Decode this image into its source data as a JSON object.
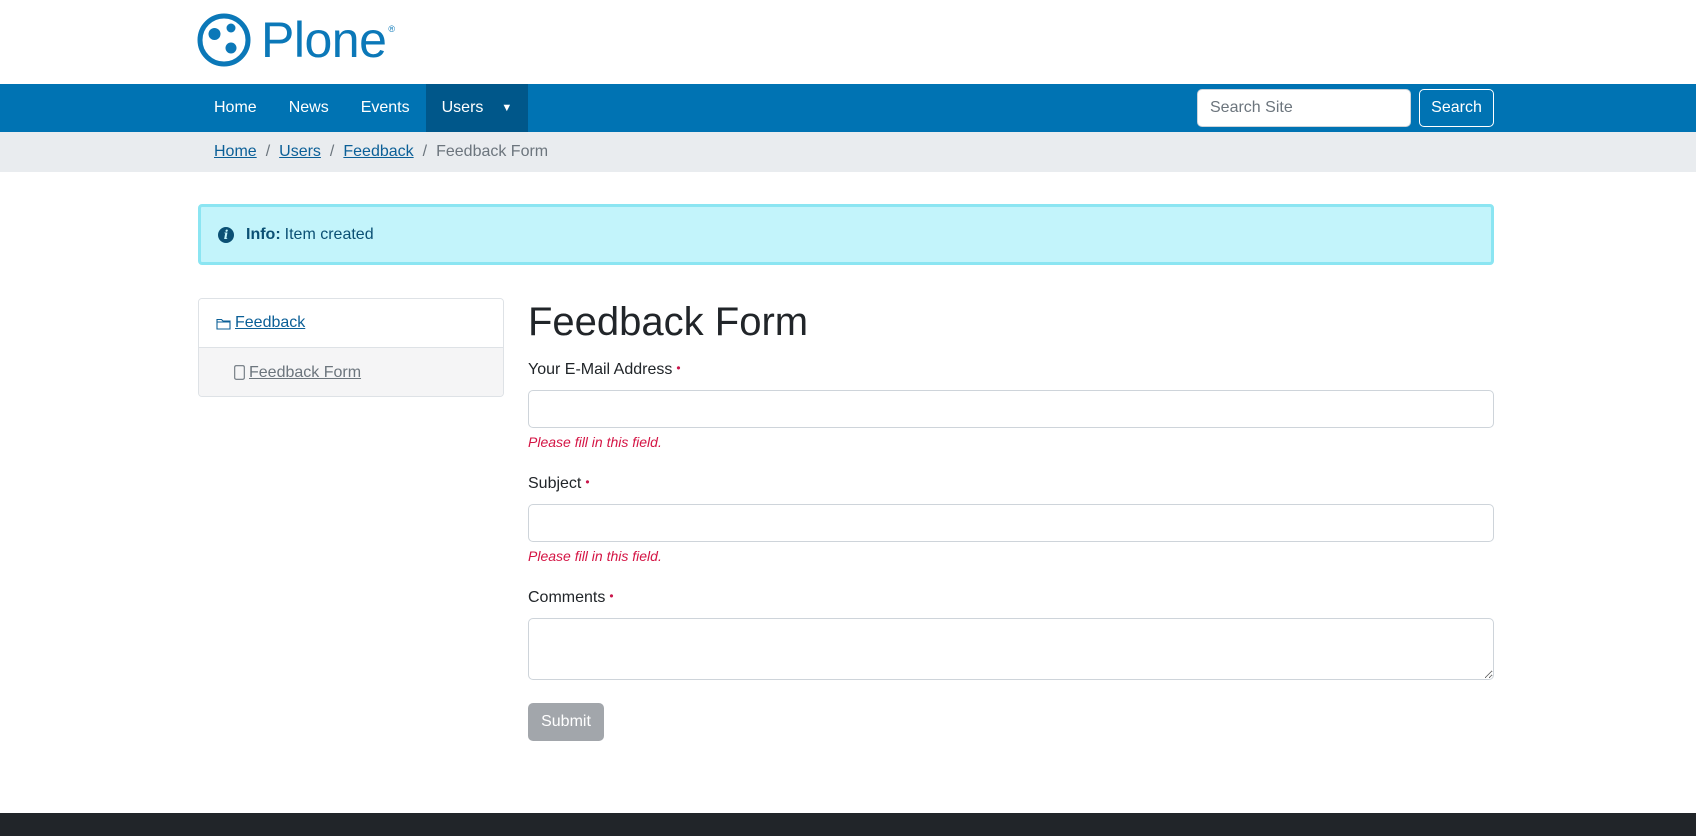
{
  "logo": {
    "text": "Plone",
    "reg": "®"
  },
  "nav": {
    "items": [
      {
        "label": "Home"
      },
      {
        "label": "News"
      },
      {
        "label": "Events"
      },
      {
        "label": "Users",
        "caret": "▼"
      }
    ],
    "search_placeholder": "Search Site",
    "search_button": "Search"
  },
  "breadcrumb": {
    "links": [
      "Home",
      "Users",
      "Feedback"
    ],
    "separator": "/",
    "current": "Feedback Form"
  },
  "alert": {
    "icon": "info-icon",
    "title": "Info:",
    "message": "Item created",
    "glyph": "i"
  },
  "portlet": {
    "header": {
      "label": "Feedback",
      "icon": "folder-icon"
    },
    "item": {
      "label": "Feedback Form",
      "icon": "document-icon"
    }
  },
  "form": {
    "title": "Feedback Form",
    "required_marker": "•",
    "fields": [
      {
        "label": "Your E-Mail Address",
        "value": "",
        "error": "Please fill in this field."
      },
      {
        "label": "Subject",
        "value": "",
        "error": "Please fill in this field."
      },
      {
        "label": "Comments",
        "value": ""
      }
    ],
    "submit_label": "Submit"
  },
  "colors": {
    "primary": "#0073b3",
    "nav_active": "#00578a",
    "alert_bg": "#c3f4fb",
    "alert_border": "#8be5f2",
    "error": "#d41444",
    "required": "#c9164b",
    "submit_disabled": "#a2a6ab",
    "footer": "#212529"
  }
}
